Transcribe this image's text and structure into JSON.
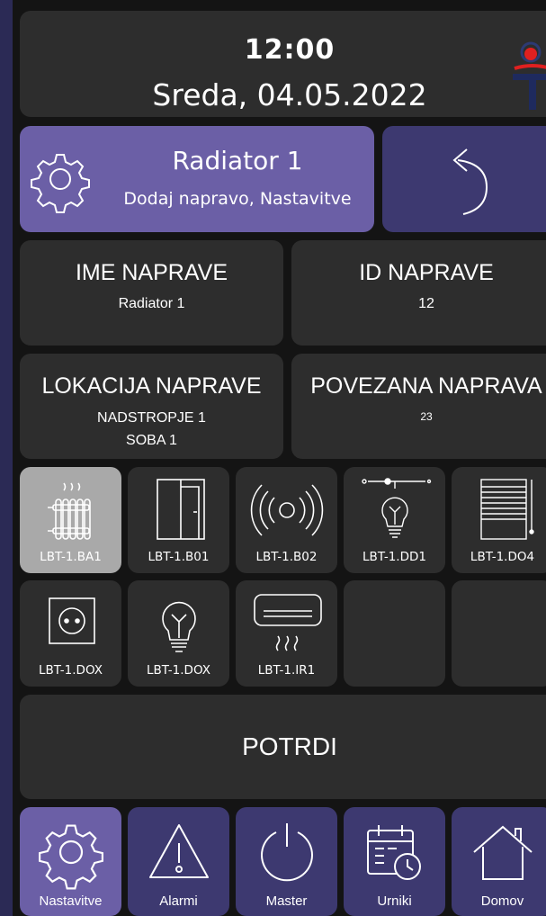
{
  "header": {
    "time": "12:00",
    "date": "Sreda, 04.05.2022",
    "logo": "company-logo"
  },
  "device_banner": {
    "name": "Radiator 1",
    "subtitle": "Dodaj napravo, Nastavitve",
    "icon": "gear-icon",
    "back_icon": "undo-arrow-icon"
  },
  "info": {
    "name_title": "IME NAPRAVE",
    "name_value": "Radiator 1",
    "id_title": "ID NAPRAVE",
    "id_value": "12",
    "location_title": "LOKACIJA NAPRAVE",
    "location_line1": "NADSTROPJE 1",
    "location_line2": "SOBA 1",
    "linked_title": "POVEZANA NAPRAVA",
    "linked_value": "23"
  },
  "devices": [
    {
      "label": "LBT-1.BA1",
      "icon": "radiator-icon",
      "selected": true
    },
    {
      "label": "LBT-1.B01",
      "icon": "door-icon",
      "selected": false
    },
    {
      "label": "LBT-1.B02",
      "icon": "wireless-signal-icon",
      "selected": false
    },
    {
      "label": "LBT-1.DD1",
      "icon": "dimmer-bulb-icon",
      "selected": false
    },
    {
      "label": "LBT-1.DO4",
      "icon": "blinds-icon",
      "selected": false
    },
    {
      "label": "LBT-1.DOX",
      "icon": "socket-icon",
      "selected": false
    },
    {
      "label": "LBT-1.DOX",
      "icon": "bulb-icon",
      "selected": false
    },
    {
      "label": "LBT-1.IR1",
      "icon": "air-conditioner-icon",
      "selected": false
    }
  ],
  "confirm_label": "POTRDI",
  "nav": [
    {
      "label": "Nastavitve",
      "icon": "gear-icon",
      "active": true
    },
    {
      "label": "Alarmi",
      "icon": "warning-icon",
      "active": false
    },
    {
      "label": "Master",
      "icon": "power-icon",
      "active": false
    },
    {
      "label": "Urniki",
      "icon": "calendar-clock-icon",
      "active": false
    },
    {
      "label": "Domov",
      "icon": "home-icon",
      "active": false
    }
  ],
  "colors": {
    "accent": "#6b5fa6",
    "accent_dark": "#3d3970",
    "tile": "#2d2d2d",
    "selected_tile": "#a9a9a9",
    "logo_red": "#e02020",
    "logo_navy": "#1e2a5e"
  }
}
